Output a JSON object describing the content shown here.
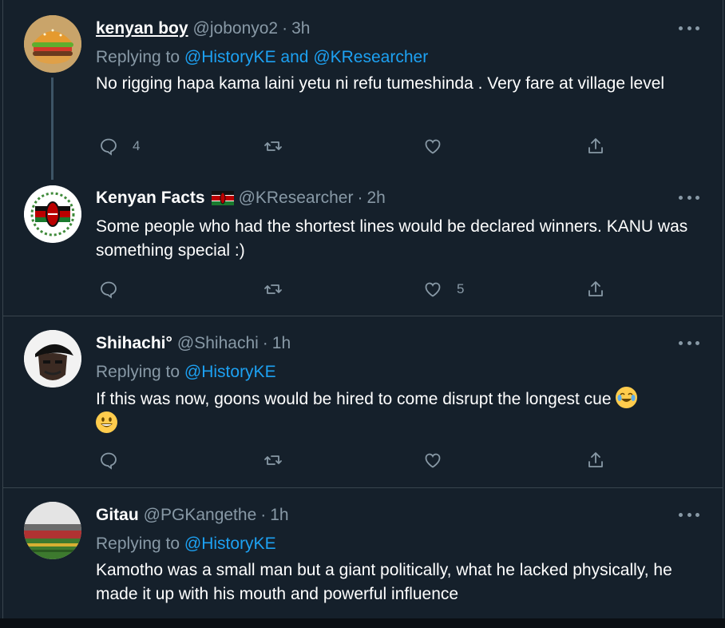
{
  "tweets": [
    {
      "name": "kenyan boy",
      "handle": "@jobonyo2",
      "dot": "·",
      "time": "3h",
      "replying_prefix": "Replying to",
      "replying_to": [
        "@HistoryKE",
        "@KResearcher"
      ],
      "replying_and": "and",
      "text": "No rigging hapa kama laini yetu ni refu tumeshinda . Very fare at village level",
      "reply_count": "4",
      "retweet_count": "",
      "like_count": "",
      "avatar_icon": "burger-avatar"
    },
    {
      "name": "Kenyan Facts",
      "flag_icon": "kenya-flag-icon",
      "handle": "@KResearcher",
      "dot": "·",
      "time": "2h",
      "text": "Some people who had the shortest lines would be declared winners. KANU was something special :)",
      "reply_count": "",
      "retweet_count": "",
      "like_count": "5",
      "avatar_icon": "kenya-shield-avatar"
    },
    {
      "name": "Shihachi°",
      "handle": "@Shihachi",
      "dot": "·",
      "time": "1h",
      "replying_prefix": "Replying to",
      "replying_to": [
        "@HistoryKE"
      ],
      "text": "If this was now, goons would be hired to come disrupt the longest cue",
      "emojis": [
        "face-with-tears-of-joy-emoji",
        "grinning-face-emoji"
      ],
      "reply_count": "",
      "retweet_count": "",
      "like_count": "",
      "avatar_icon": "person-cap-avatar"
    },
    {
      "name": "Gitau",
      "handle": "@PGKangethe",
      "dot": "·",
      "time": "1h",
      "replying_prefix": "Replying to",
      "replying_to": [
        "@HistoryKE"
      ],
      "text": "Kamotho was a small man but a giant politically, what he lacked physically, he made it up with his mouth and powerful influence",
      "avatar_icon": "stadium-avatar"
    }
  ],
  "colors": {
    "background": "#15202b",
    "border": "#38444d",
    "muted": "#8899a6",
    "link": "#1da1f2",
    "text": "#ffffff"
  },
  "action_icons": [
    "reply-icon",
    "retweet-icon",
    "like-icon",
    "share-icon"
  ]
}
